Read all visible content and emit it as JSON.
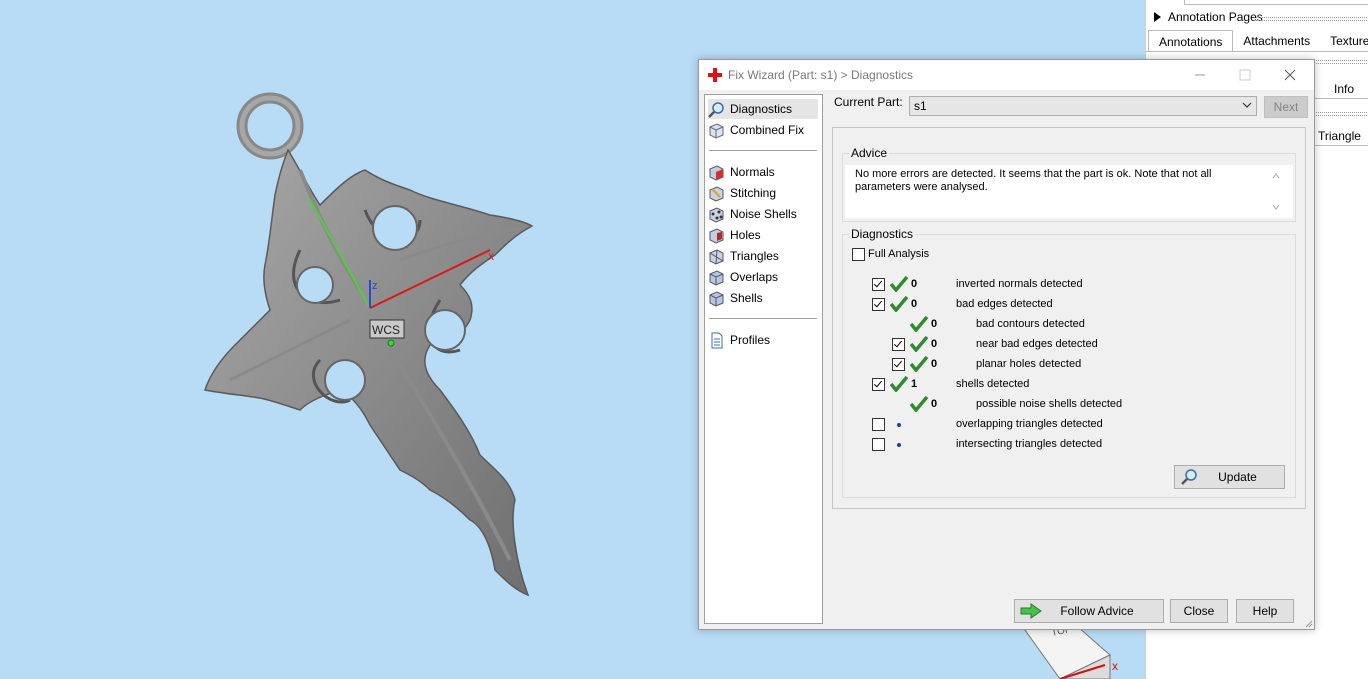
{
  "right_panel": {
    "annotation_pages": "Annotation Pages",
    "tabs": [
      "Annotations",
      "Attachments",
      "Texture"
    ],
    "info": "Info",
    "triangle": "Triangle"
  },
  "viewport": {
    "wcs_label": "WCS",
    "axis_x": "x",
    "axis_z": "z",
    "cube_top": "TOP"
  },
  "dialog": {
    "title": "Fix Wizard (Part: s1) > Diagnostics",
    "nav": {
      "diagnostics": "Diagnostics",
      "combined_fix": "Combined Fix",
      "normals": "Normals",
      "stitching": "Stitching",
      "noise_shells": "Noise Shells",
      "holes": "Holes",
      "triangles": "Triangles",
      "overlaps": "Overlaps",
      "shells": "Shells",
      "profiles": "Profiles"
    },
    "current_part_label": "Current Part:",
    "current_part_value": "s1",
    "next_label": "Next",
    "advice_title": "Advice",
    "advice_text": "No more errors are detected. It seems that the part is ok. Note that not all parameters were analysed.",
    "diagnostics_title": "Diagnostics",
    "full_analysis": "Full Analysis",
    "rows": [
      {
        "count": "0",
        "label": "inverted normals detected"
      },
      {
        "count": "0",
        "label": "bad edges detected"
      },
      {
        "count": "0",
        "label": "bad contours detected"
      },
      {
        "count": "0",
        "label": "near bad edges detected"
      },
      {
        "count": "0",
        "label": "planar holes detected"
      },
      {
        "count": "1",
        "label": "shells detected"
      },
      {
        "count": "0",
        "label": "possible noise shells detected"
      },
      {
        "count": "",
        "label": "overlapping triangles detected"
      },
      {
        "count": "",
        "label": "intersecting triangles detected"
      }
    ],
    "update_label": "Update",
    "follow_advice_label": "Follow Advice",
    "close_label": "Close",
    "help_label": "Help"
  }
}
